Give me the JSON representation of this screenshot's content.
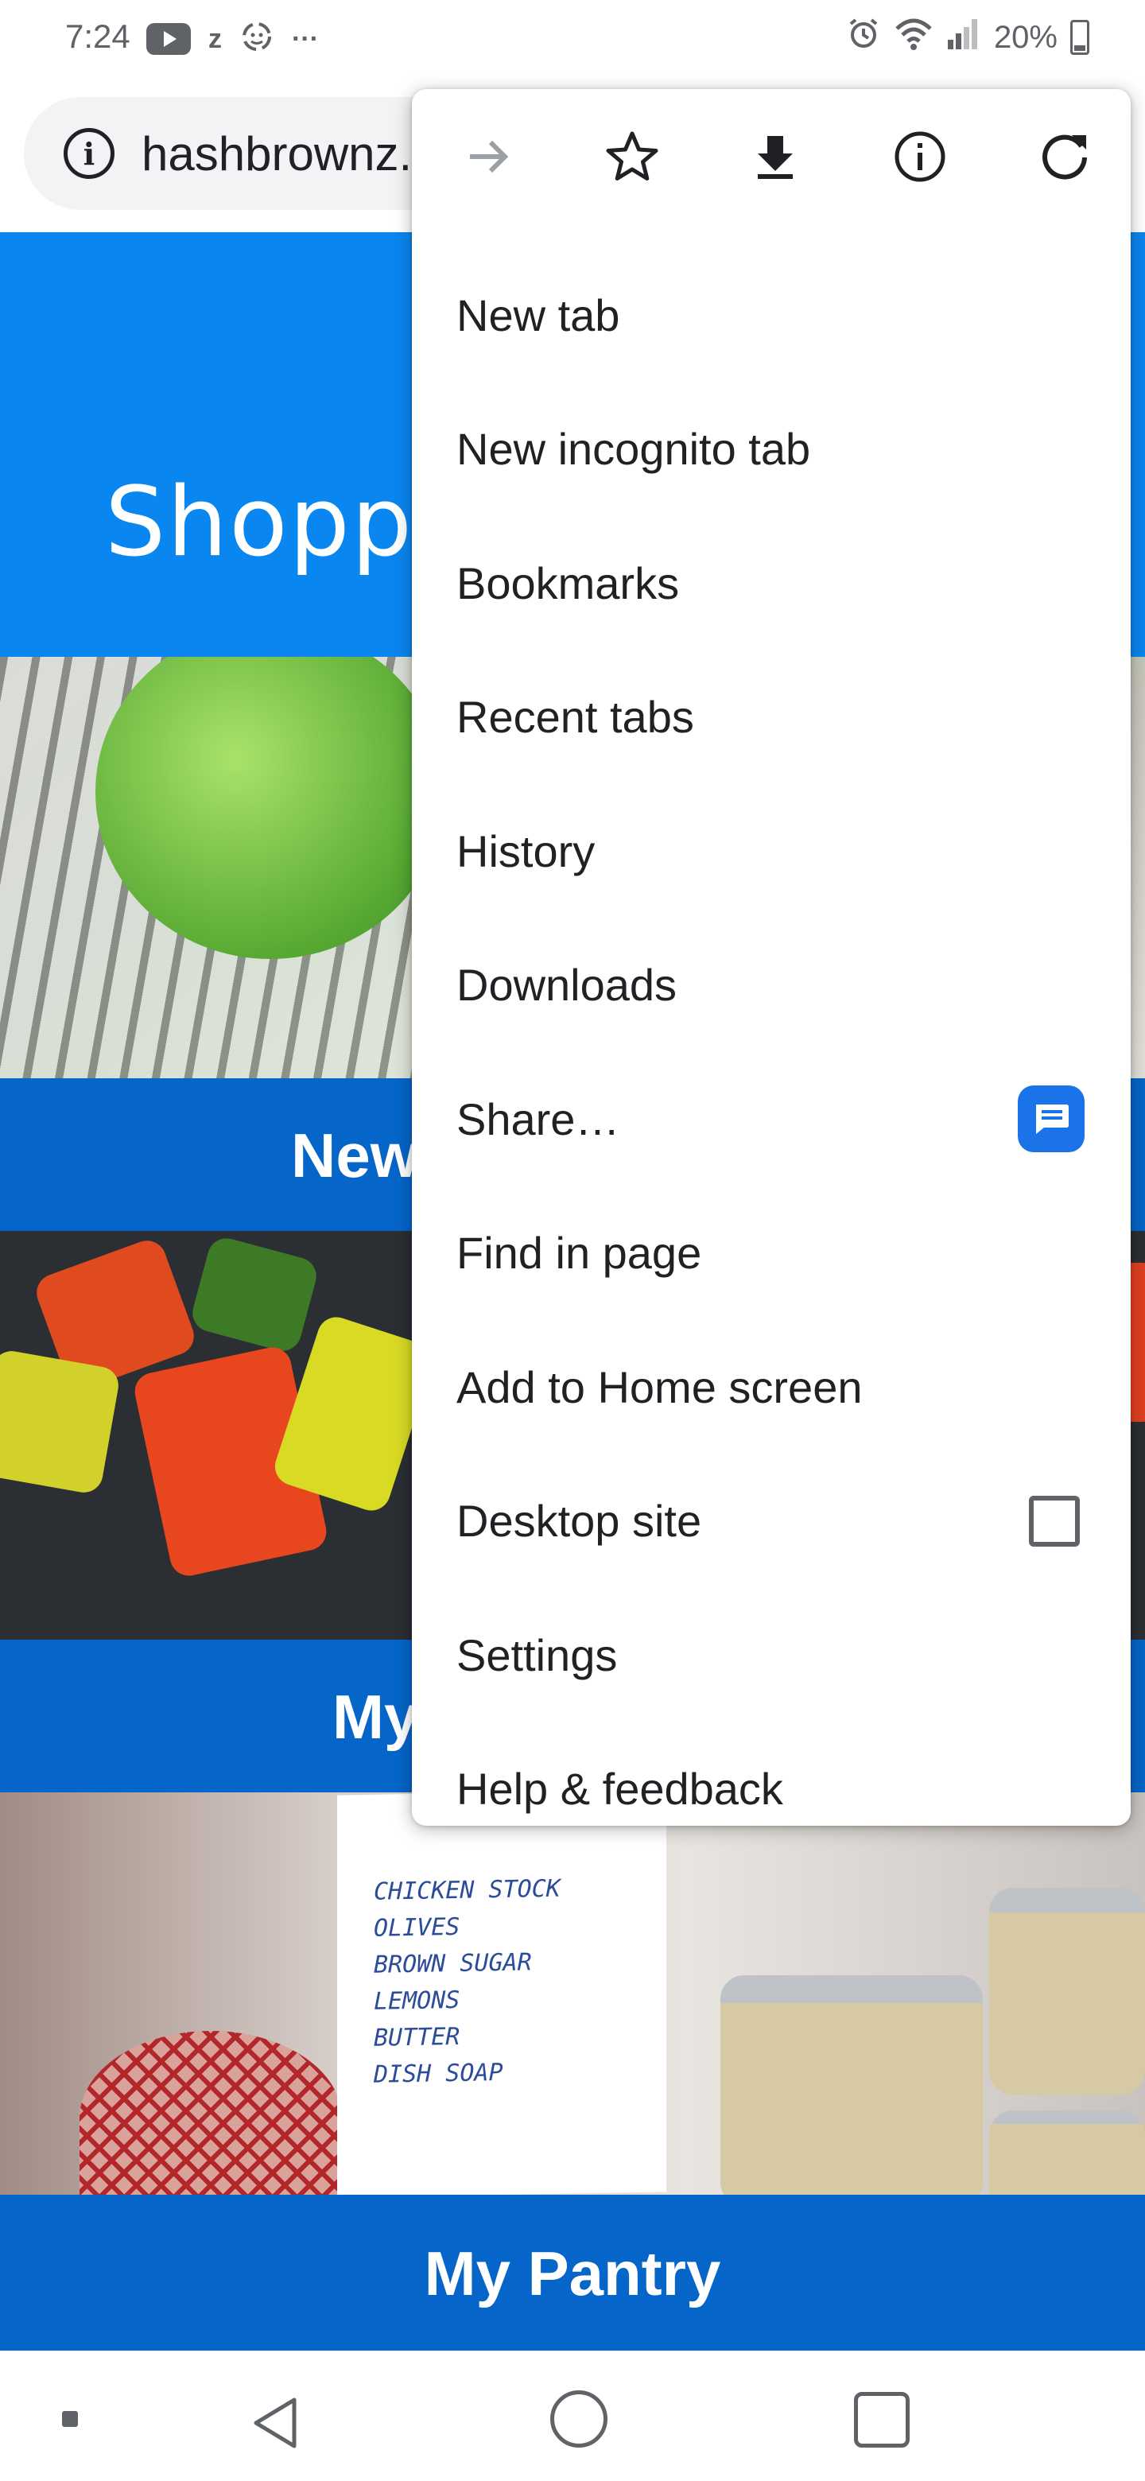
{
  "status_bar": {
    "time": "7:24",
    "left_icons": [
      "youtube-icon",
      "zoom-z-icon",
      "sync-face-icon",
      "more-notifications-icon"
    ],
    "more_glyph": "···",
    "z_glyph": "z",
    "battery_percent": "20%",
    "right_icons": [
      "alarm-icon",
      "wifi-icon",
      "signal-icon",
      "battery-icon"
    ]
  },
  "toolbar": {
    "url_text": "hashbrownz.",
    "info_glyph": "i"
  },
  "page": {
    "hero_title": "Shoppin",
    "band_1_label": "New",
    "band_2_label": "My",
    "band_3_label": "My Pantry",
    "note_lines": [
      "CHICKEN STOCK",
      "OLIVES",
      "BROWN SUGAR",
      "LEMONS",
      "BUTTER",
      "DISH SOAP"
    ]
  },
  "menu": {
    "top_icons": [
      "forward-icon",
      "bookmark-star-icon",
      "download-icon",
      "page-info-icon",
      "reload-icon"
    ],
    "items": [
      {
        "label": "New tab"
      },
      {
        "label": "New incognito tab"
      },
      {
        "label": "Bookmarks"
      },
      {
        "label": "Recent tabs"
      },
      {
        "label": "History"
      },
      {
        "label": "Downloads"
      },
      {
        "label": "Share…"
      },
      {
        "label": "Find in page"
      },
      {
        "label": "Add to Home screen"
      },
      {
        "label": "Desktop site",
        "checked": false
      },
      {
        "label": "Settings"
      },
      {
        "label": "Help & feedback"
      }
    ]
  },
  "navbar": {
    "buttons": [
      "recent-apps-dot",
      "back-button",
      "home-button",
      "overview-button"
    ]
  },
  "colors": {
    "hero_blue": "#0a86f0",
    "band_blue": "#0565c9",
    "share_badge": "#1a73e8",
    "icon_grey": "#5f6368"
  }
}
